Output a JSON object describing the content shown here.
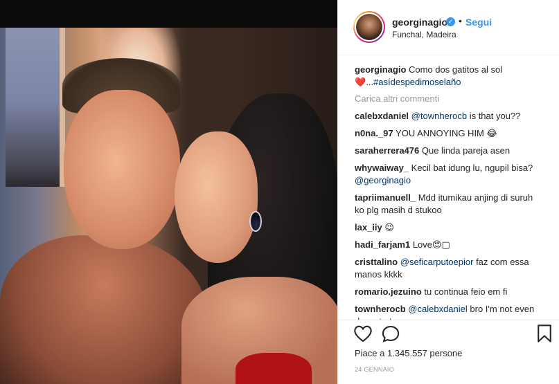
{
  "post": {
    "username": "georginagio",
    "verified_symbol": "✓",
    "separator": "•",
    "follow_label": "Segui",
    "location": "Funchal, Madeira",
    "caption_text": "Como dos gatitos al sol",
    "caption_emoji": "❤️",
    "caption_ellipsis": "...",
    "caption_hashtag": "#asídespedimoselaño",
    "load_more": "Carica altri commenti",
    "likes": "Piace a 1.345.557 persone",
    "date": "24 GENNAIO"
  },
  "comments": [
    {
      "user": "calebxdaniel",
      "mention": "@townherocb",
      "text": " is that you??"
    },
    {
      "user": "n0na._97",
      "mention": "",
      "text": " YOU ANNOYING HIM 😂"
    },
    {
      "user": "saraherrera476",
      "mention": "",
      "text": " Que linda pareja asen"
    },
    {
      "user": "whywaiway_",
      "mention": "",
      "text": " Kecil bat idung lu, ngupil bisa?",
      "mention_after": "@georginagio"
    },
    {
      "user": "tapriimanuell_",
      "mention": "",
      "text": " Mdd itumikau anjing di suruh ko plg masih d stukoo"
    },
    {
      "user": "lax_iiy",
      "mention": "",
      "text": " 😉"
    },
    {
      "user": "hadi_farjam1",
      "mention": "",
      "text": " Love😍▢"
    },
    {
      "user": "cristtalino",
      "mention": "@seficarputoepior",
      "text": " faz com essa manos kkkk"
    },
    {
      "user": "romario.jezuino",
      "mention": "",
      "text": " tu continua feio em fi"
    },
    {
      "user": "townherocb",
      "mention": "@calebxdaniel",
      "text": " bro I'm not even decent at soccer"
    }
  ],
  "icons": {
    "like": "heart-icon",
    "comment": "comment-bubble-icon",
    "save": "bookmark-icon",
    "verified": "verified-badge-icon"
  },
  "colors": {
    "link_blue": "#3897f0",
    "mention_blue": "#003569",
    "text": "#262626",
    "muted": "#999999"
  }
}
